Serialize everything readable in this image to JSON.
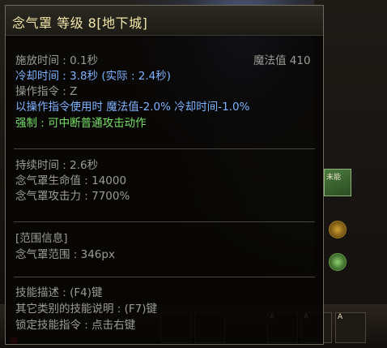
{
  "tooltip": {
    "title": "念气罩 等级 8[地下城]",
    "lines": {
      "cast_time": "施放时间 : 0.1秒",
      "mana": "魔法值 410",
      "cooldown": "冷却时间 : 3.8秒 (实际 : 2.4秒)",
      "command": "操作指令 : Z",
      "command_bonus": "以操作指令使用时 魔法值-2.0% 冷却时间-1.0%",
      "super_armor": "强制 : 可中断普通攻击动作",
      "duration": "持续时间 : 2.6秒",
      "hp": "念气罩生命值 : 14000",
      "attack": "念气罩攻击力 : 7700%",
      "range_header": "[范围信息]",
      "range": "念气罩范围 : 346px",
      "desc_key": "技能描述 : (F4)键",
      "other_desc_key": "其它类别的技能说明 : (F7)键",
      "lock_key": "锁定技能指令 : 点击右键"
    }
  },
  "background": {
    "skill_slot_label": "未能",
    "badge": "A"
  },
  "colors": {
    "title": "#f2e6a8",
    "gray_text": "#9c9c94",
    "blue_text": "#7fb2ff",
    "green_text": "#79e06a",
    "border": "#6f6a5c"
  }
}
